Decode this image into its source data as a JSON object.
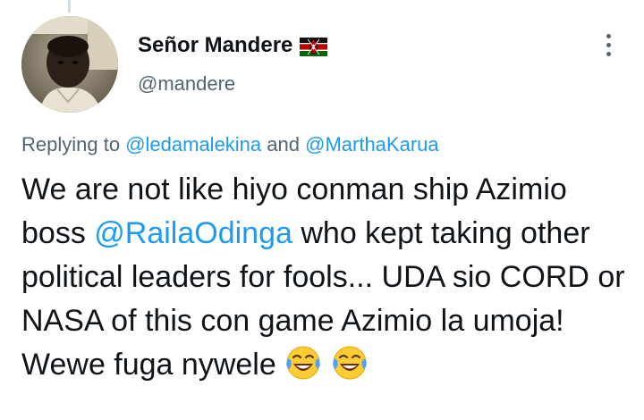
{
  "user": {
    "display_name": "Señor Mandere",
    "handle": "@mandere",
    "flag_icon": "kenya-flag-icon"
  },
  "reply": {
    "prefix": "Replying to ",
    "mention1": "@ledamalekina",
    "conj": " and ",
    "mention2": "@MarthaKarua"
  },
  "tweet": {
    "text_before": "We are not like hiyo conman ship Azimio boss ",
    "mention": "@RailaOdinga",
    "text_after": " who kept taking other political leaders for fools... UDA sio CORD or NASA of this con game Azimio la umoja! Wewe fuga nywele ",
    "emoji_icon": "face-with-tears-of-joy-icon"
  },
  "colors": {
    "link": "#1d9bf0",
    "secondary_text": "#536471",
    "primary_text": "#0f1419"
  }
}
